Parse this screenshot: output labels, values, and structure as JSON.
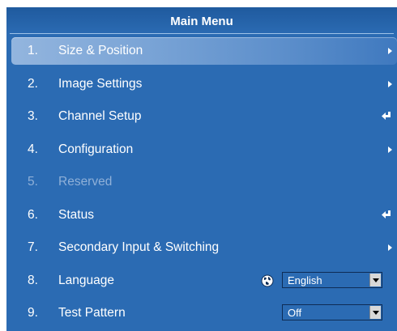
{
  "menu": {
    "title": "Main Menu",
    "items": [
      {
        "number": "1.",
        "label": "Size & Position",
        "indicator": "submenu-arrow-icon",
        "state": "selected"
      },
      {
        "number": "2.",
        "label": "Image Settings",
        "indicator": "submenu-arrow-icon",
        "state": "normal"
      },
      {
        "number": "3.",
        "label": "Channel Setup",
        "indicator": "enter-icon",
        "state": "normal"
      },
      {
        "number": "4.",
        "label": "Configuration",
        "indicator": "submenu-arrow-icon",
        "state": "normal"
      },
      {
        "number": "5.",
        "label": "Reserved",
        "indicator": "",
        "state": "disabled"
      },
      {
        "number": "6.",
        "label": "Status",
        "indicator": "enter-icon",
        "state": "normal"
      },
      {
        "number": "7.",
        "label": "Secondary Input & Switching",
        "indicator": "submenu-arrow-icon",
        "state": "normal"
      },
      {
        "number": "8.",
        "label": "Language",
        "control": {
          "type": "select",
          "value": "English",
          "icon": "globe-icon"
        },
        "state": "normal"
      },
      {
        "number": "9.",
        "label": "Test Pattern",
        "control": {
          "type": "select",
          "value": "Off"
        },
        "state": "normal"
      }
    ]
  },
  "colors": {
    "background": "#2b6bb3",
    "highlight": "#7aa4d6",
    "text": "#ffffff",
    "disabled_text": "#8fb0d8"
  }
}
